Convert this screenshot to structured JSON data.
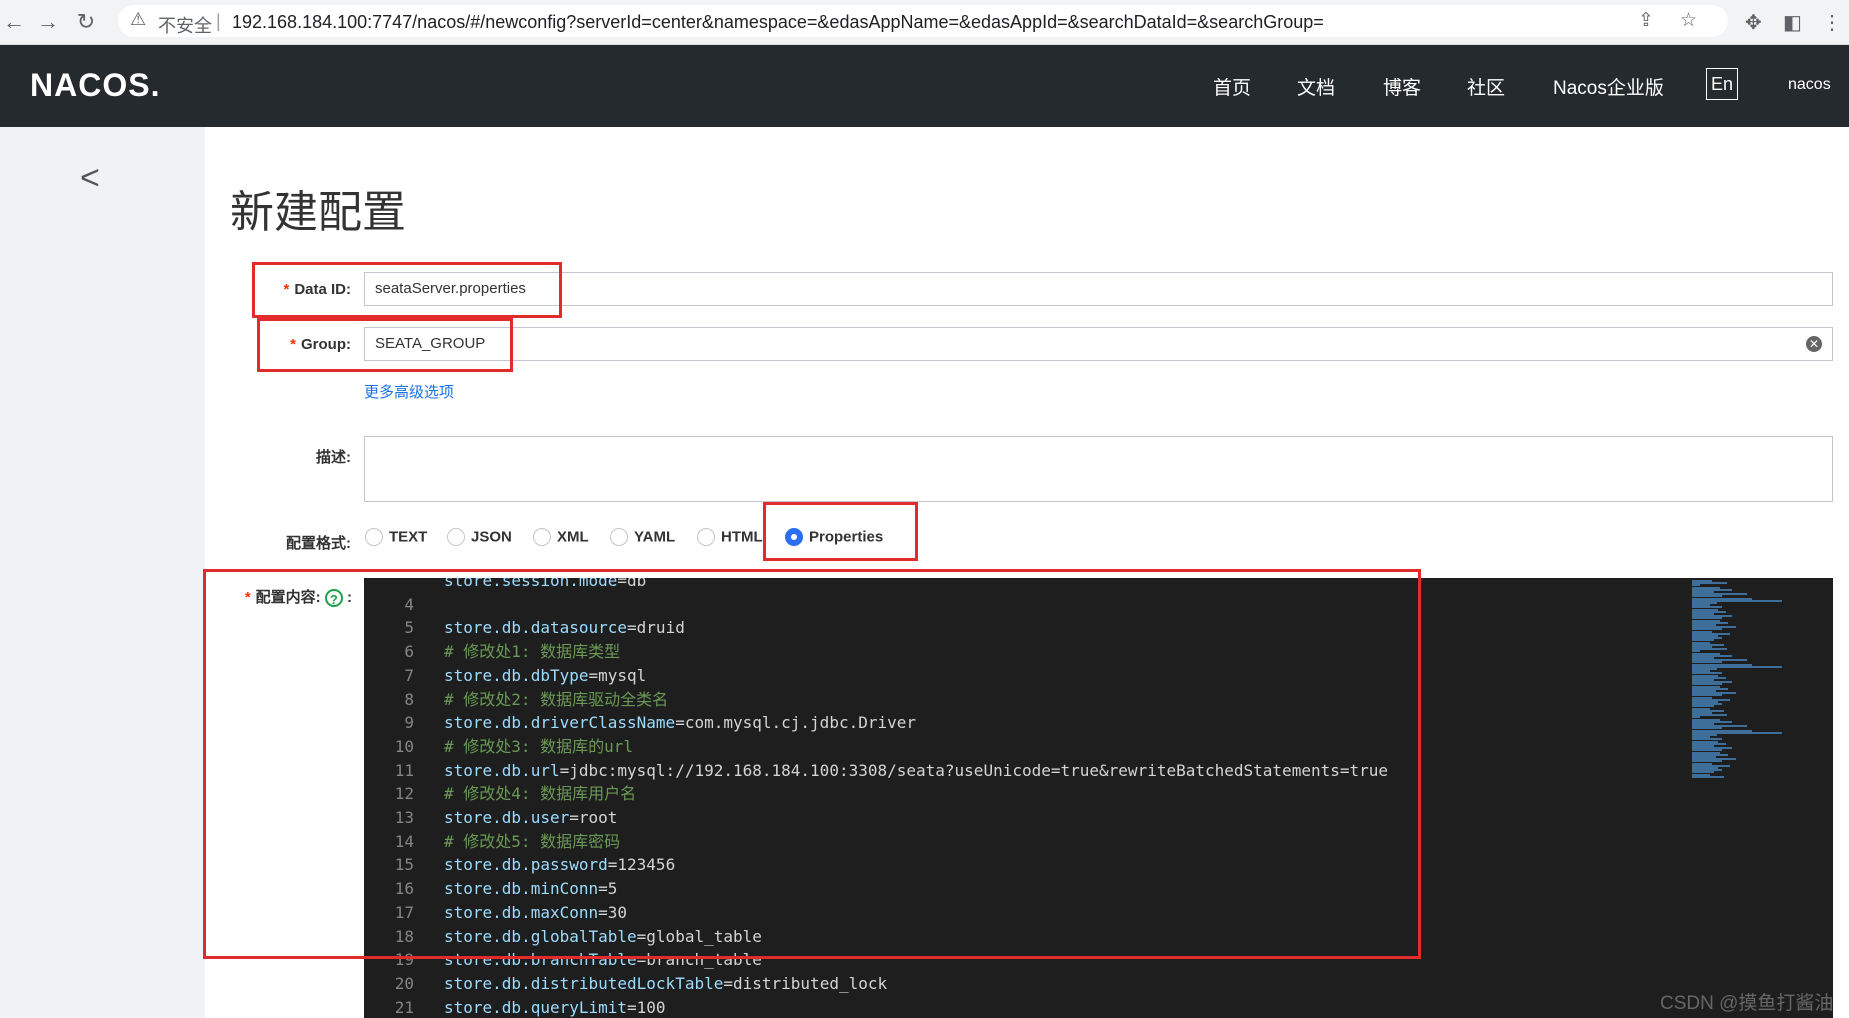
{
  "browser": {
    "security_label": "不安全",
    "url": "192.168.184.100:7747/nacos/#/newconfig?serverId=center&namespace=&edasAppName=&edasAppId=&searchDataId=&searchGroup="
  },
  "header": {
    "logo": "NACOS.",
    "menu": [
      "首页",
      "文档",
      "博客",
      "社区",
      "Nacos企业版"
    ],
    "lang_button": "En",
    "user": "nacos"
  },
  "page": {
    "title": "新建配置"
  },
  "form": {
    "data_id_label": "Data ID:",
    "data_id_value": "seataServer.properties",
    "group_label": "Group:",
    "group_value": "SEATA_GROUP",
    "advanced_link": "更多高级选项",
    "desc_label": "描述:",
    "format_label": "配置格式:",
    "formats": [
      "TEXT",
      "JSON",
      "XML",
      "YAML",
      "HTML",
      "Properties"
    ],
    "selected_format": "Properties",
    "content_label": "配置内容:",
    "content_help": "?"
  },
  "editor": {
    "lines": [
      {
        "n": "",
        "key": "store.session.mode",
        "val": "=db",
        "comment": ""
      },
      {
        "n": "4",
        "key": "",
        "val": "",
        "comment": ""
      },
      {
        "n": "5",
        "key": "store.db.datasource",
        "val": "=druid",
        "comment": ""
      },
      {
        "n": "6",
        "key": "",
        "val": "",
        "comment": "# 修改处1: 数据库类型"
      },
      {
        "n": "7",
        "key": "store.db.dbType",
        "val": "=mysql",
        "comment": ""
      },
      {
        "n": "8",
        "key": "",
        "val": "",
        "comment": "# 修改处2: 数据库驱动全类名"
      },
      {
        "n": "9",
        "key": "store.db.driverClassName",
        "val": "=com.mysql.cj.jdbc.Driver",
        "comment": ""
      },
      {
        "n": "10",
        "key": "",
        "val": "",
        "comment": "# 修改处3: 数据库的url"
      },
      {
        "n": "11",
        "key": "store.db.url",
        "val": "=jdbc:mysql://192.168.184.100:3308/seata?useUnicode=true&rewriteBatchedStatements=true",
        "comment": ""
      },
      {
        "n": "12",
        "key": "",
        "val": "",
        "comment": "# 修改处4: 数据库用户名"
      },
      {
        "n": "13",
        "key": "store.db.user",
        "val": "=root",
        "comment": ""
      },
      {
        "n": "14",
        "key": "",
        "val": "",
        "comment": "# 修改处5: 数据库密码"
      },
      {
        "n": "15",
        "key": "store.db.password",
        "val": "=123456",
        "comment": ""
      },
      {
        "n": "16",
        "key": "store.db.minConn",
        "val": "=5",
        "comment": ""
      },
      {
        "n": "17",
        "key": "store.db.maxConn",
        "val": "=30",
        "comment": ""
      },
      {
        "n": "18",
        "key": "store.db.globalTable",
        "val": "=global_table",
        "comment": ""
      },
      {
        "n": "19",
        "key": "store.db.branchTable",
        "val": "=branch_table",
        "comment": ""
      },
      {
        "n": "20",
        "key": "store.db.distributedLockTable",
        "val": "=distributed_lock",
        "comment": ""
      },
      {
        "n": "21",
        "key": "store.db.queryLimit",
        "val": "=100",
        "comment": ""
      }
    ]
  },
  "watermark": "CSDN @摸鱼打酱油"
}
